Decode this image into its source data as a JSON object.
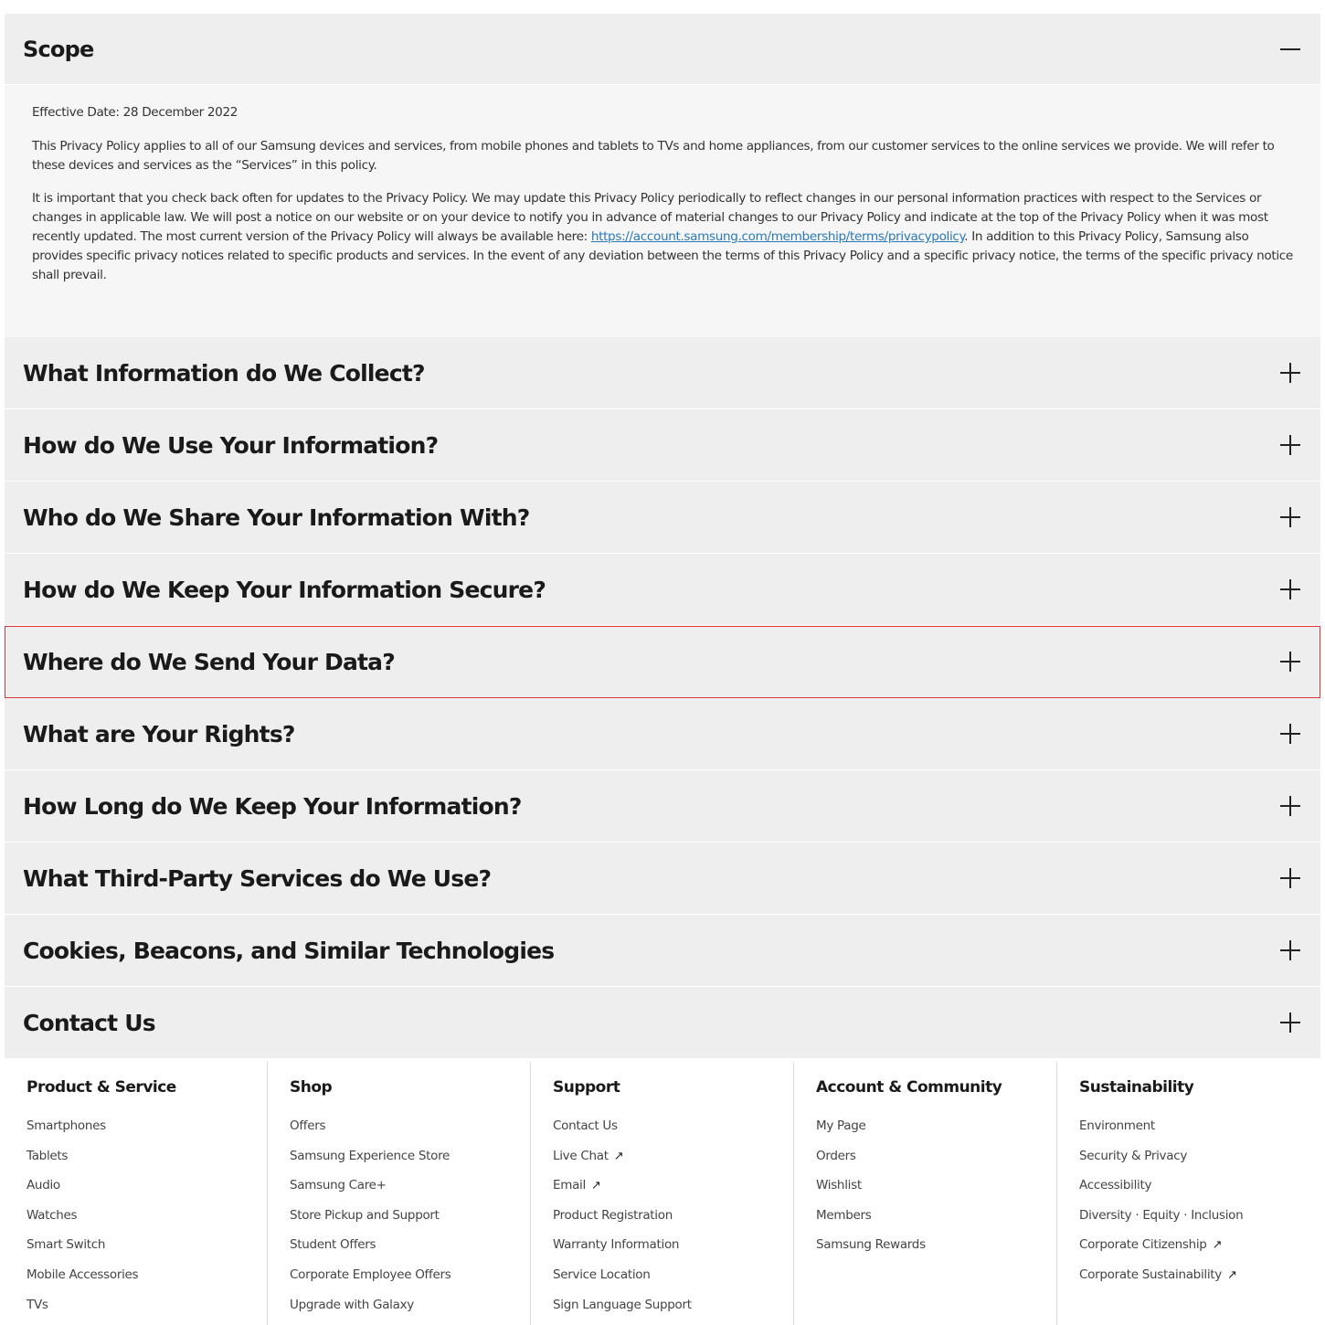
{
  "accordion": {
    "scope": {
      "title": "Scope",
      "effective_date": "Effective Date: 28 December 2022",
      "para1": "This Privacy Policy applies to all of our Samsung devices and services, from mobile phones and tablets to TVs and home appliances, from our customer services to the online services we provide. We will refer to these devices and services as the “Services” in this policy.",
      "para2_before_link": "It is important that you check back often for updates to the Privacy Policy. We may update this Privacy Policy periodically to reflect changes in our personal information practices with respect to the Services or changes in applicable law. We will post a notice on our website or on your device to notify you in advance of material changes to our Privacy Policy and indicate at the top of the Privacy Policy when it was most recently updated. The most current version of the Privacy Policy will always be available here: ",
      "para2_link": "https://account.samsung.com/membership/terms/privacypolicy",
      "para2_after_link": ". In addition to this Privacy Policy, Samsung also provides specific privacy notices related to specific products and services. In the event of any deviation between the terms of this Privacy Policy and a specific privacy notice, the terms of the specific privacy notice shall prevail."
    },
    "sections": [
      "What Information do We Collect?",
      "How do We Use Your Information?",
      "Who do We Share Your Information With?",
      "How do We Keep Your Information Secure?",
      "Where do We Send Your Data?",
      "What are Your Rights?",
      "How Long do We Keep Your Information?",
      "What Third-Party Services do We Use?",
      "Cookies, Beacons, and Similar Technologies",
      "Contact Us"
    ]
  },
  "footer": {
    "columns": [
      {
        "title": "Product & Service",
        "items": [
          "Smartphones",
          "Tablets",
          "Audio",
          "Watches",
          "Smart Switch",
          "Mobile Accessories",
          "TVs"
        ]
      },
      {
        "title": "Shop",
        "items": [
          "Offers",
          "Samsung Experience Store",
          "Samsung Care+",
          "Store Pickup and Support",
          "Student Offers",
          "Corporate Employee Offers",
          "Upgrade with Galaxy"
        ]
      },
      {
        "title": "Support",
        "items": [
          "Contact Us",
          "Live Chat",
          "Email",
          "Product Registration",
          "Warranty Information",
          "Service Location",
          "Sign Language Support"
        ]
      },
      {
        "title": "Account & Community",
        "items": [
          "My Page",
          "Orders",
          "Wishlist",
          "Members",
          "Samsung Rewards"
        ]
      },
      {
        "title": "Sustainability",
        "items": [
          "Environment",
          "Security & Privacy",
          "Accessibility",
          "Diversity · Equity · Inclusion",
          "Corporate Citizenship",
          "Corporate Sustainability"
        ]
      }
    ],
    "external_arrow": "↗"
  }
}
